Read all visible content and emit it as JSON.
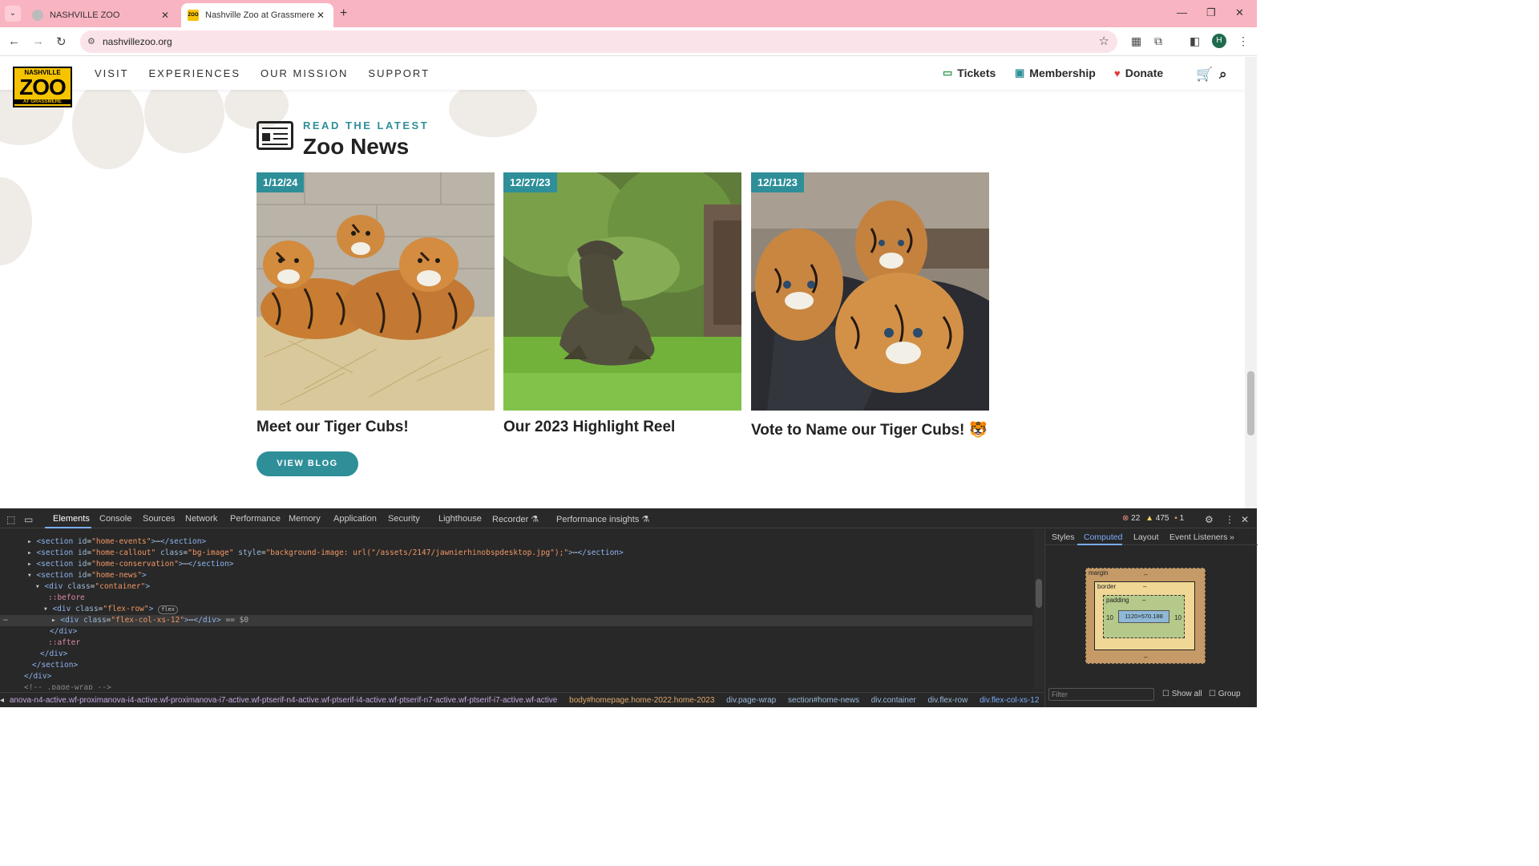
{
  "browser": {
    "tabs": [
      {
        "title": "NASHVILLE ZOO",
        "close": "✕"
      },
      {
        "title": "Nashville Zoo at Grassmere | Na",
        "close": "✕"
      }
    ],
    "new_tab": "+",
    "url": "nashvillezoo.org",
    "profile_initial": "H"
  },
  "site": {
    "logo": {
      "line1": "NASHVILLE",
      "line2": "ZOO",
      "line3": "AT GRASSMERE"
    },
    "nav": [
      "VISIT",
      "EXPERIENCES",
      "OUR MISSION",
      "SUPPORT"
    ],
    "utility": {
      "tickets": "Tickets",
      "membership": "Membership",
      "donate": "Donate"
    },
    "news": {
      "kicker": "READ THE LATEST",
      "title": "Zoo News",
      "cards": [
        {
          "date": "1/12/24",
          "title": "Meet our Tiger Cubs!",
          "image": "tiger-cubs-in-hay"
        },
        {
          "date": "12/27/23",
          "title": "Our 2023 Highlight Reel",
          "image": "komodo-dragon-on-grass"
        },
        {
          "date": "12/11/23",
          "title": "Vote to Name our Tiger Cubs! 🐯",
          "image": "tiger-cubs-on-blanket"
        }
      ],
      "view_blog": "VIEW BLOG"
    }
  },
  "devtools": {
    "tabs": [
      "Elements",
      "Console",
      "Sources",
      "Network",
      "Performance",
      "Memory",
      "Application",
      "Security",
      "Lighthouse",
      "Recorder ⚗",
      "Performance insights ⚗"
    ],
    "active_tab": "Elements",
    "counts": {
      "errors": "22",
      "warnings": "475",
      "issues": "1"
    },
    "dom": {
      "l1": {
        "id": "\"home-events\""
      },
      "l2": {
        "id": "\"home-callout\"",
        "class": "\"bg-image\"",
        "style": "\"background-image: url(\"/assets/2147/jawnierhinobspdesktop.jpg\");\""
      },
      "l3": {
        "id": "\"home-conservation\""
      },
      "l4": {
        "id": "\"home-news\""
      },
      "l5": {
        "class": "\"container\""
      },
      "l6": "::before",
      "l7": {
        "class": "\"flex-row\"",
        "badge": "flex"
      },
      "l8": {
        "class": "\"flex-col-xs-12\"",
        "eq": "== $0"
      },
      "l10": "::after",
      "l13": "<!-- .page-wrap -->"
    },
    "breadcrumbs": [
      "anova-n4-active.wf-proximanova-i4-active.wf-proximanova-i7-active.wf-ptserif-n4-active.wf-ptserif-i4-active.wf-ptserif-n7-active.wf-ptserif-i7-active.wf-active",
      "body#homepage.home-2022.home-2023",
      "div.page-wrap",
      "section#home-news",
      "div.container",
      "div.flex-row",
      "div.flex-col-xs-12"
    ],
    "sidebar": {
      "tabs": [
        "Styles",
        "Computed",
        "Layout",
        "Event Listeners"
      ],
      "active_tab": "Computed",
      "box_model": {
        "margin": "margin",
        "border": "border",
        "padding": "padding",
        "size": "1120×570.188",
        "pad_left": "10",
        "pad_right": "10",
        "dash": "–"
      },
      "filter_placeholder": "Filter",
      "show_all": "Show all",
      "group": "Group"
    }
  }
}
